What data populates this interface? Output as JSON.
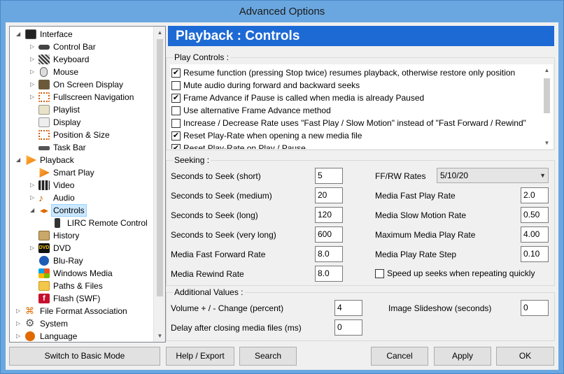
{
  "window": {
    "title": "Advanced Options"
  },
  "tree": {
    "items": [
      {
        "label": "Interface"
      },
      {
        "label": "Control Bar"
      },
      {
        "label": "Keyboard"
      },
      {
        "label": "Mouse"
      },
      {
        "label": "On Screen Display"
      },
      {
        "label": "Fullscreen Navigation"
      },
      {
        "label": "Playlist"
      },
      {
        "label": "Display"
      },
      {
        "label": "Position & Size"
      },
      {
        "label": "Task Bar"
      },
      {
        "label": "Playback"
      },
      {
        "label": "Smart Play"
      },
      {
        "label": "Video"
      },
      {
        "label": "Audio"
      },
      {
        "label": "Controls"
      },
      {
        "label": "LIRC Remote Control"
      },
      {
        "label": "History"
      },
      {
        "label": "DVD"
      },
      {
        "label": "Blu-Ray"
      },
      {
        "label": "Windows Media"
      },
      {
        "label": "Paths & Files"
      },
      {
        "label": "Flash (SWF)"
      },
      {
        "label": "File Format Association"
      },
      {
        "label": "System"
      },
      {
        "label": "Language"
      }
    ]
  },
  "header": {
    "title": "Playback : Controls"
  },
  "play_controls": {
    "title": "Play Controls :",
    "items": [
      {
        "label": "Resume function (pressing Stop twice) resumes playback, otherwise restore only position",
        "checked": true
      },
      {
        "label": "Mute audio during forward and backward seeks",
        "checked": false
      },
      {
        "label": "Frame Advance if Pause is called when media is already Paused",
        "checked": true
      },
      {
        "label": "Use alternative Frame Advance method",
        "checked": false
      },
      {
        "label": "Increase / Decrease Rate uses \"Fast Play / Slow Motion\" instead of \"Fast Forward / Rewind\"",
        "checked": false
      },
      {
        "label": "Reset Play-Rate when opening a new media file",
        "checked": true
      },
      {
        "label": "Reset Play-Rate on Play / Pause",
        "checked": true
      }
    ]
  },
  "seeking": {
    "title": "Seeking :",
    "seek_short_label": "Seconds to Seek (short)",
    "seek_short": "5",
    "seek_medium_label": "Seconds to Seek (medium)",
    "seek_medium": "20",
    "seek_long_label": "Seconds to Seek (long)",
    "seek_long": "120",
    "seek_vlong_label": "Seconds to Seek (very long)",
    "seek_vlong": "600",
    "ff_rate_label": "Media Fast Forward Rate",
    "ff_rate": "8.0",
    "rew_rate_label": "Media Rewind Rate",
    "rew_rate": "8.0",
    "ffrw_rates_label": "FF/RW Rates",
    "ffrw_rates": "5/10/20",
    "fast_play_label": "Media Fast Play Rate",
    "fast_play": "2.0",
    "slow_motion_label": "Media Slow Motion Rate",
    "slow_motion": "0.50",
    "max_rate_label": "Maximum Media Play Rate",
    "max_rate": "4.00",
    "rate_step_label": "Media Play Rate Step",
    "rate_step": "0.10",
    "speedup_label": "Speed up seeks when repeating quickly",
    "speedup_checked": false
  },
  "additional": {
    "title": "Additional Values :",
    "volume_label": "Volume + / - Change (percent)",
    "volume": "4",
    "slideshow_label": "Image Slideshow (seconds)",
    "slideshow": "0",
    "delay_label": "Delay after closing media files (ms)",
    "delay": "0"
  },
  "buttons": {
    "basic_mode": "Switch to Basic Mode",
    "help_export": "Help / Export",
    "search": "Search",
    "cancel": "Cancel",
    "apply": "Apply",
    "ok": "OK"
  },
  "colors": {
    "header_bg": "#1d6ad5",
    "title_bar": "#6aa7e0",
    "selection": "#cce8ff"
  }
}
